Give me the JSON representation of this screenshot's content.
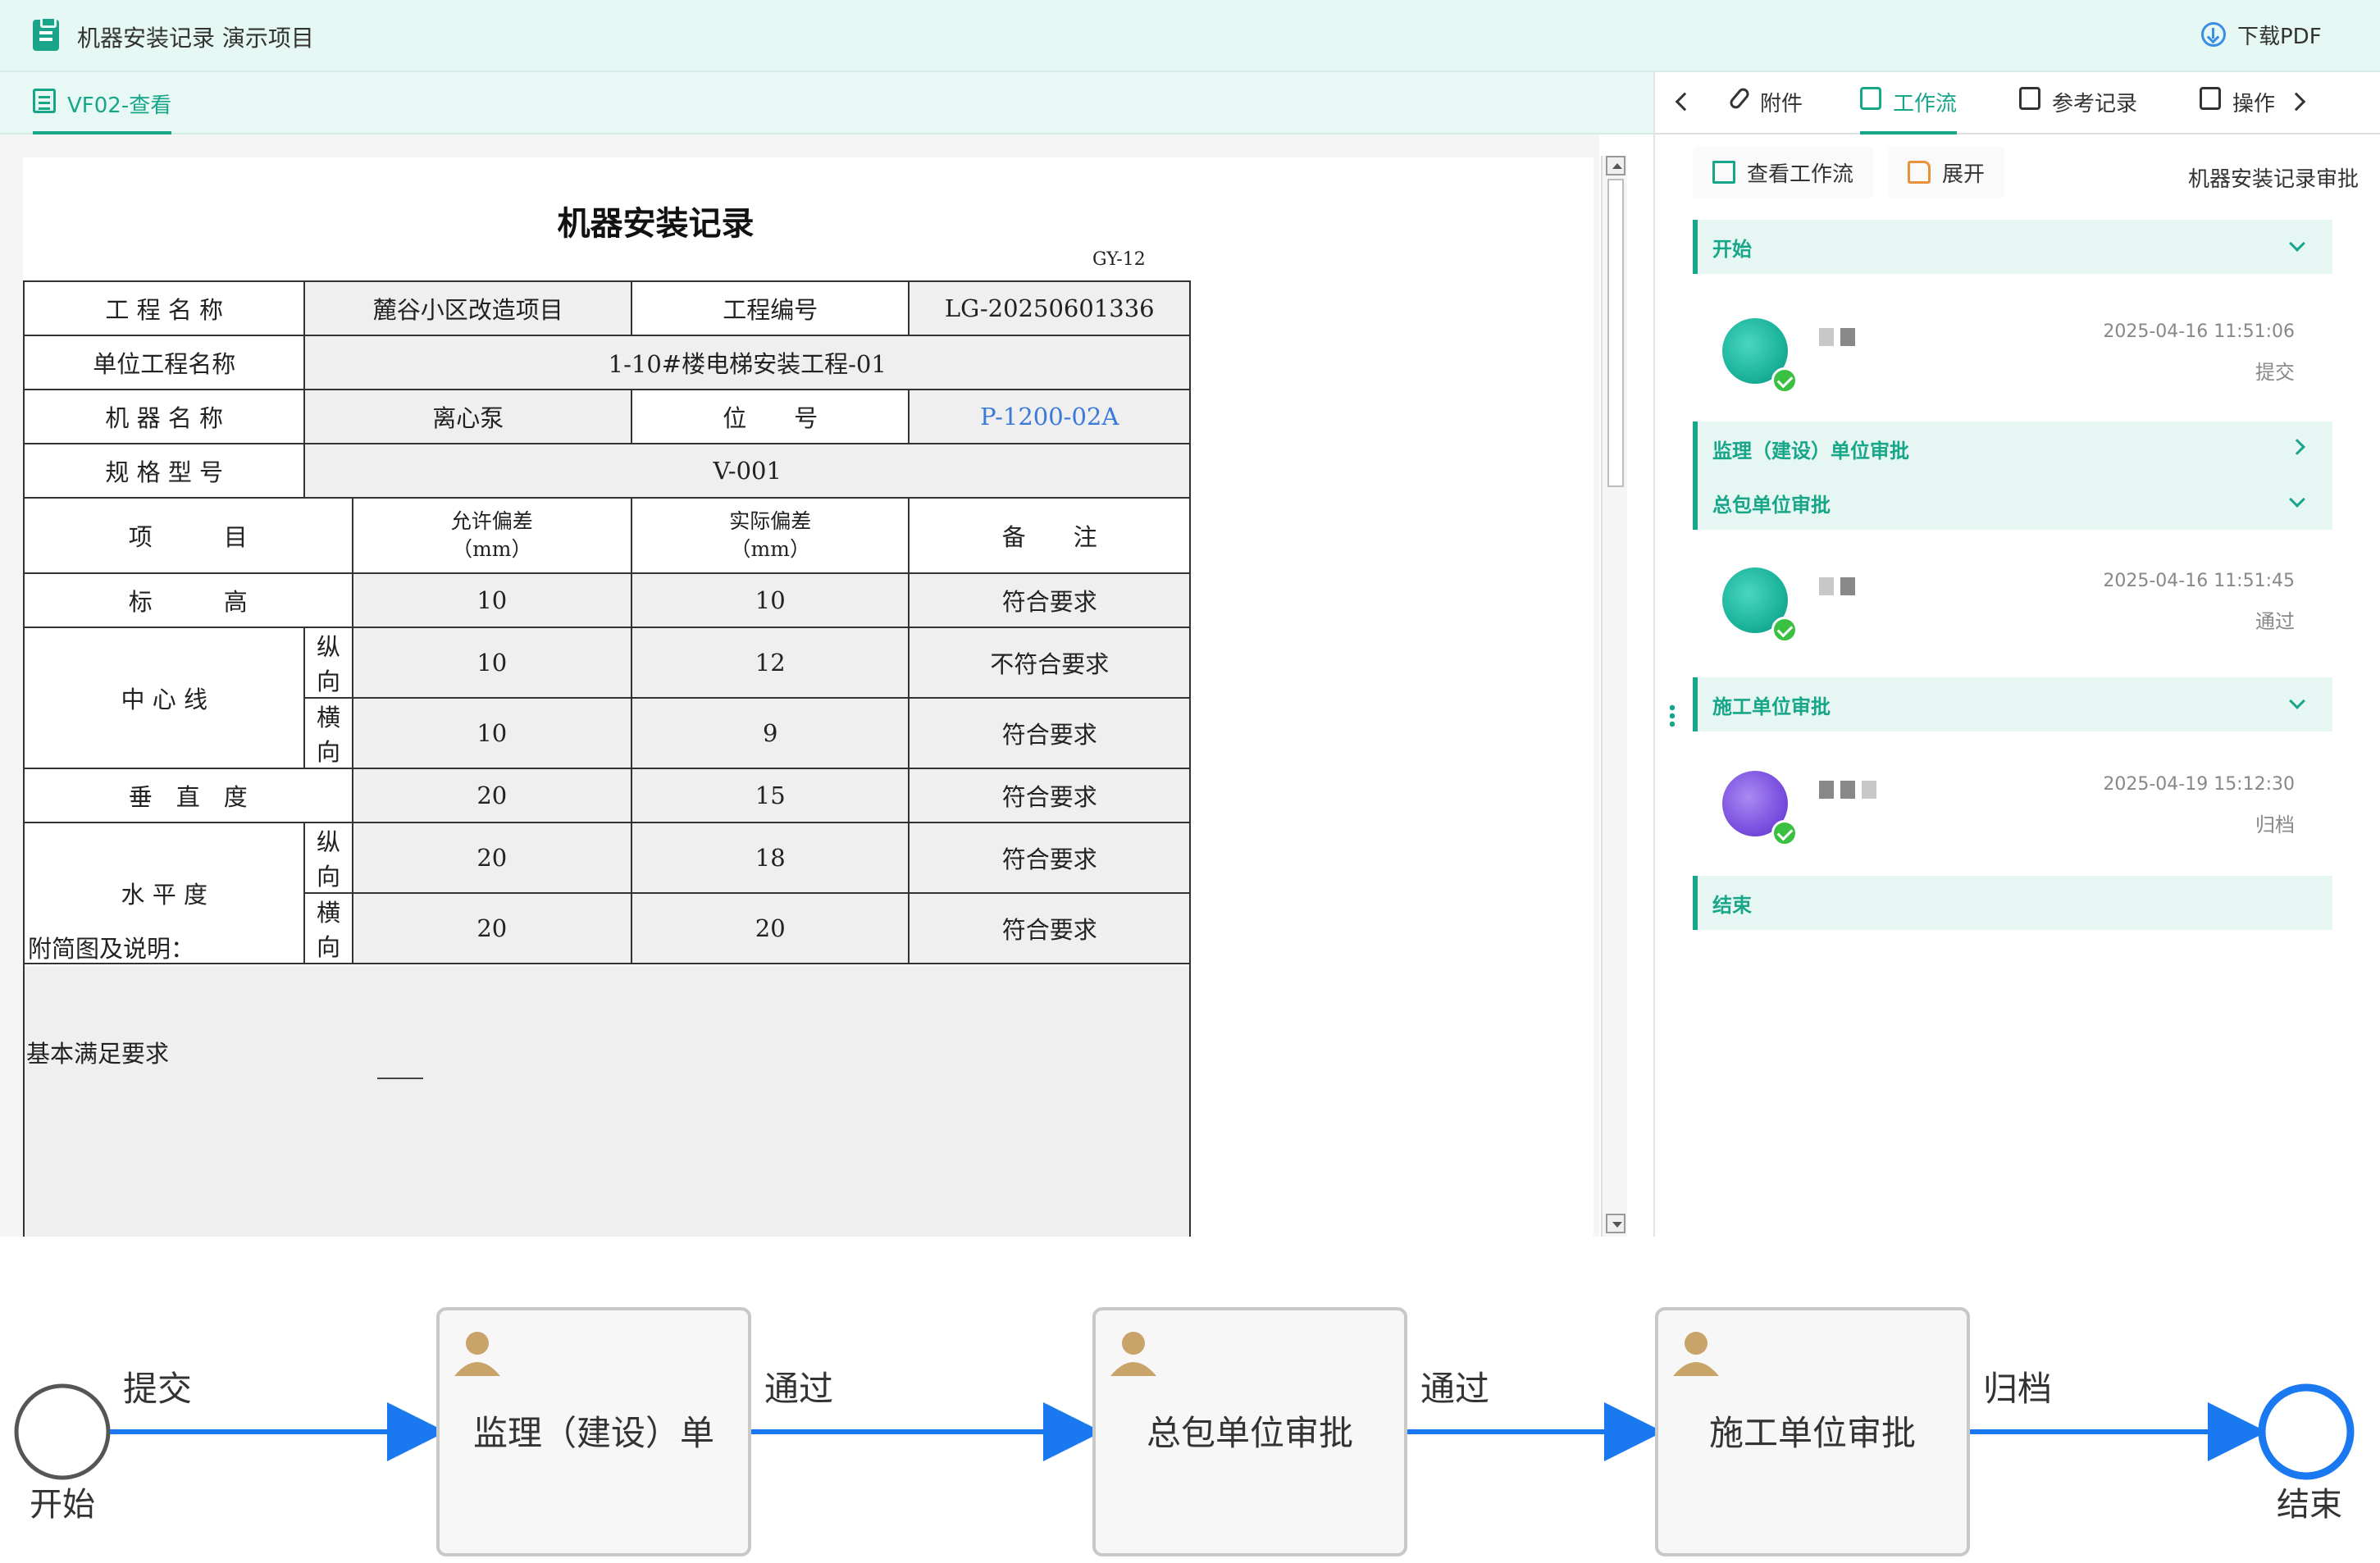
{
  "app": {
    "title": "机器安装记录 演示项目",
    "download_label": "下载PDF",
    "doc_tab_label": "VF02-查看"
  },
  "document": {
    "title": "机器安装记录",
    "code": "GY-12",
    "rows": {
      "project_name_label": "工 程 名 称",
      "project_name": "麓谷小区改造项目",
      "project_no_label": "工程编号",
      "project_no": "LG-20250601336",
      "unit_label": "单位工程名称",
      "unit_value": "1-10#楼电梯安装工程-01",
      "machine_label": "机 器 名 称",
      "machine_value": "离心泵",
      "position_label": "位　　号",
      "position_value": "P-1200-02A",
      "spec_label": "规 格 型 号",
      "spec_value": "V-001"
    },
    "header": {
      "item": "项　　　目",
      "allow": "允许偏差",
      "allow_unit": "（mm）",
      "actual": "实际偏差",
      "actual_unit": "（mm）",
      "remark": "备　　注"
    },
    "measurements": {
      "elevation_label": "标　　　高",
      "elevation": [
        "10",
        "10",
        "符合要求"
      ],
      "center_label": "中 心 线",
      "center_long_label": "纵向",
      "center_long": [
        "10",
        "12",
        "不符合要求"
      ],
      "center_trans_label": "横向",
      "center_trans": [
        "10",
        "9",
        "符合要求"
      ],
      "vertical_label": "垂　直　度",
      "vertical": [
        "20",
        "15",
        "符合要求"
      ],
      "level_label": "水 平 度",
      "level_long_label": "纵向",
      "level_long": [
        "20",
        "18",
        "符合要求"
      ],
      "level_trans_label": "横向",
      "level_trans": [
        "20",
        "20",
        "符合要求"
      ]
    },
    "attach_label": "附简图及说明：",
    "attach_text": "基本满足要求"
  },
  "right_panel": {
    "tabs": [
      "附件",
      "工作流",
      "参考记录",
      "操作"
    ],
    "active_tab": "工作流",
    "view_workflow": "查看工作流",
    "expand": "展开",
    "workflow_name": "机器安装记录审批",
    "stages": {
      "start": "开始",
      "supervision": "监理（建设）单位审批",
      "general": "总包单位审批",
      "construction": "施工单位审批",
      "end": "结束"
    },
    "entries": [
      {
        "time": "2025-04-16 11:51:06",
        "action": "提交"
      },
      {
        "time": "2025-04-16 11:51:45",
        "action": "通过"
      },
      {
        "time": "2025-04-19 15:12:30",
        "action": "归档"
      }
    ]
  },
  "flow": {
    "start": "开始",
    "end": "结束",
    "nodes": [
      "监理（建设）单",
      "总包单位审批",
      "施工单位审批"
    ],
    "edges": [
      "提交",
      "通过",
      "通过",
      "归档"
    ],
    "colors": {
      "edge": "#1a78f0",
      "end": "#1a78f0",
      "start": "#555555",
      "user_icon": "#c9a46a"
    }
  }
}
